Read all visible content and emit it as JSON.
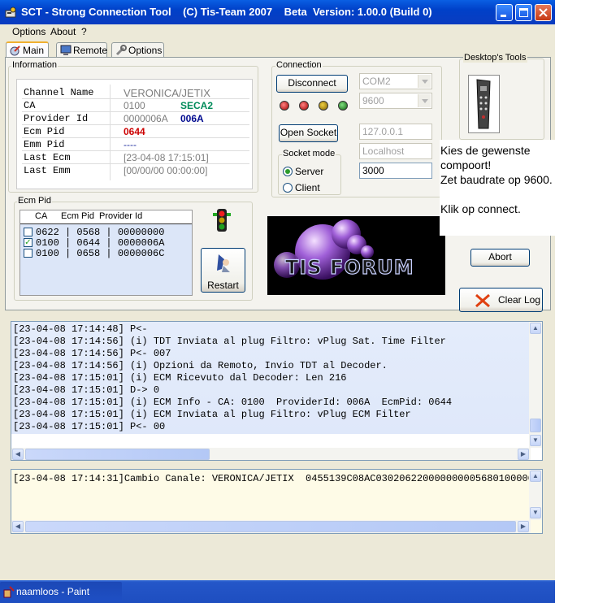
{
  "window": {
    "title": "SCT - Strong Connection Tool    (C) Tis-Team 2007    Beta  Version: 1.00.0 (Build 0)"
  },
  "menu": {
    "items": [
      "Options",
      "About",
      "?"
    ]
  },
  "tabs": [
    {
      "label": "Main",
      "active": true
    },
    {
      "label": "Remote",
      "active": false
    },
    {
      "label": "Options",
      "active": false
    }
  ],
  "information": {
    "group_title": "Information",
    "rows": [
      {
        "label": "Channel Name",
        "value": "VERONICA/JETIX",
        "extra": ""
      },
      {
        "label": "CA",
        "value": "0100",
        "extra": "SECA2"
      },
      {
        "label": "Provider Id",
        "value": "0000006A",
        "extra": "006A"
      },
      {
        "label": "Ecm Pid",
        "value": "0644",
        "extra": ""
      },
      {
        "label": "Emm Pid",
        "value": "----",
        "extra": ""
      },
      {
        "label": "Last Ecm",
        "value": "[23-04-08 17:15:01]",
        "extra": ""
      },
      {
        "label": "Last Emm",
        "value": "[00/00/00 00:00:00]",
        "extra": ""
      }
    ]
  },
  "ecm_pid": {
    "group_title": "Ecm Pid",
    "headers": [
      "CA",
      "Ecm Pid",
      "Provider Id"
    ],
    "rows": [
      {
        "text": "0622 | 0568 | 00000000",
        "checked": false
      },
      {
        "text": "0100 | 0644 | 0000006A",
        "checked": true
      },
      {
        "text": "0100 | 0658 | 0000006C",
        "checked": false
      }
    ],
    "restart_label": "Restart"
  },
  "connection": {
    "group_title": "Connection",
    "disconnect_label": "Disconnect",
    "port": "COM2",
    "baud": "9600",
    "open_socket_label": "Open Socket",
    "ip": "127.0.0.1",
    "host": "Localhost",
    "socket_port": "3000",
    "socket_mode_title": "Socket mode",
    "mode_server": "Server",
    "mode_client": "Client",
    "mode_selected": "Server"
  },
  "banner": {
    "text": "TIS FORUM"
  },
  "desktop_tools": {
    "group_title": "Desktop's Tools",
    "abort_label": "Abort",
    "clear_log_label": "Clear Log"
  },
  "note": {
    "lines": [
      "Kies de gewenste",
      "compoort!",
      "Zet baudrate op 9600.",
      "",
      "Klik op connect."
    ]
  },
  "log": {
    "lines": [
      "[23-04-08 17:14:48] P<-",
      "[23-04-08 17:14:56] (i) TDT Inviata al plug Filtro: vPlug Sat. Time Filter",
      "[23-04-08 17:14:56] P<- 007",
      "[23-04-08 17:14:56] (i) Opzioni da Remoto, Invio TDT al Decoder.",
      "[23-04-08 17:15:01] (i) ECM Ricevuto dal Decoder: Len 216",
      "[23-04-08 17:15:01] D-> 0",
      "[23-04-08 17:15:01] (i) ECM Info - CA: 0100  ProviderId: 006A  EcmPid: 0644",
      "[23-04-08 17:15:01] (i) ECM Inviata al plug Filtro: vPlug ECM Filter",
      "[23-04-08 17:15:01] P<- 00"
    ]
  },
  "log2": {
    "line": "[23-04-08 17:14:31]Cambio Canale: VERONICA/JETIX  0455139C08AC030206220000000005680100000"
  },
  "taskbar": {
    "item": "naamloos - Paint"
  },
  "colors": {
    "ecm_red": "#cc0000",
    "seca_green": "#008b5a",
    "provider_blue": "#000a8f"
  }
}
